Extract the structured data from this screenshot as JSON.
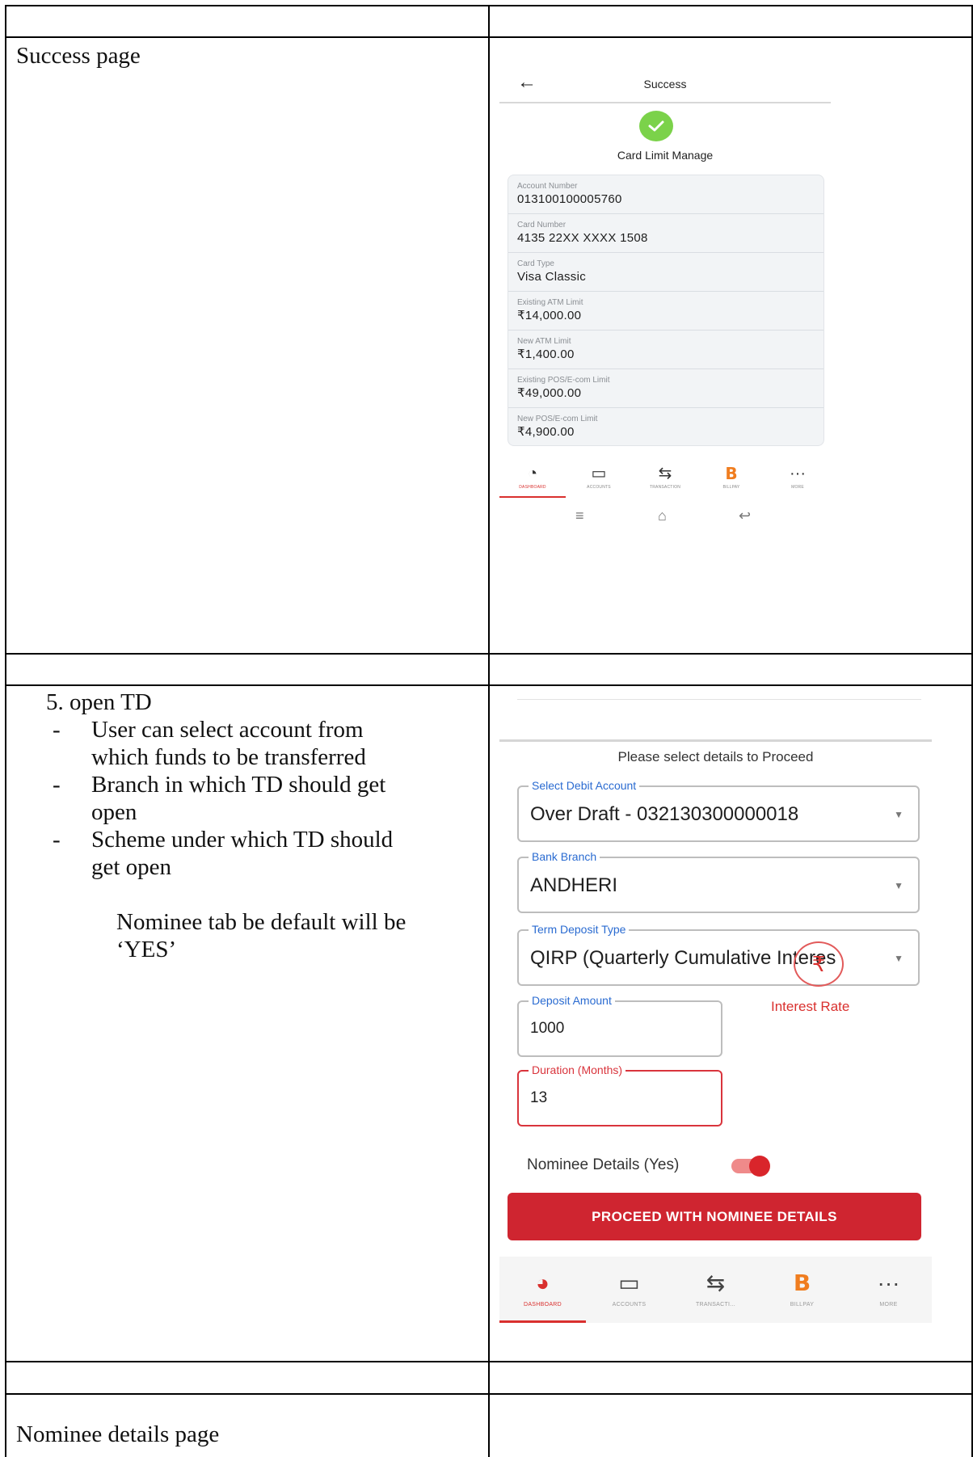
{
  "doc": {
    "row1_label": "Success page",
    "row2": {
      "item": "5.  open TD",
      "bullets": [
        "User can select account from",
        "which funds to be transferred",
        "Branch in which TD should get",
        "open",
        "Scheme under which TD should",
        "get open"
      ],
      "note_line1": "Nominee tab be default will be",
      "note_line2": "‘YES’"
    },
    "row3_label": "Nominee details page"
  },
  "success_screen": {
    "back_icon": "arrow-left-icon",
    "title": "Success",
    "status_icon": "check-circle-icon",
    "subtitle": "Card Limit Manage",
    "details": [
      {
        "label": "Account Number",
        "value": "013100100005760"
      },
      {
        "label": "Card Number",
        "value": "4135 22XX XXXX 1508"
      },
      {
        "label": "Card Type",
        "value": "Visa Classic"
      },
      {
        "label": "Existing ATM Limit",
        "value": "₹14,000.00"
      },
      {
        "label": "New ATM Limit",
        "value": "₹1,400.00"
      },
      {
        "label": "Existing POS/E-com Limit",
        "value": "₹49,000.00"
      },
      {
        "label": "New POS/E-com Limit",
        "value": "₹4,900.00"
      }
    ],
    "tabs": [
      {
        "label": "DASHBOARD",
        "icon": "dashboard-icon"
      },
      {
        "label": "ACCOUNTS",
        "icon": "wallet-icon"
      },
      {
        "label": "TRANSACTION",
        "icon": "transfer-icon"
      },
      {
        "label": "BILLPAY",
        "icon": "billpay-icon"
      },
      {
        "label": "MORE",
        "icon": "more-icon"
      }
    ],
    "active_tab": "DASHBOARD",
    "accent_color": "#d9302e",
    "success_color": "#7bd24a"
  },
  "open_td_screen": {
    "hint": "Please select details to Proceed",
    "debit_account": {
      "label": "Select Debit Account",
      "value": "Over Draft - 032130300000018"
    },
    "bank_branch": {
      "label": "Bank Branch",
      "value": "ANDHERI"
    },
    "deposit_type": {
      "label": "Term Deposit Type",
      "value": "QIRP (Quarterly Cumulative Interes"
    },
    "deposit_amount": {
      "label": "Deposit Amount",
      "value": "1000"
    },
    "duration": {
      "label": "Duration (Months)",
      "value": "13"
    },
    "interest_rate_label": "Interest Rate",
    "rupee_symbol": "₹",
    "nominee_toggle_label": "Nominee Details (Yes)",
    "nominee_toggle_on": true,
    "proceed_button": "PROCEED WITH NOMINEE DETAILS",
    "tabs": [
      {
        "label": "DASHBOARD",
        "icon": "dashboard-icon"
      },
      {
        "label": "ACCOUNTS",
        "icon": "wallet-icon"
      },
      {
        "label": "TRANSACTI...",
        "icon": "transfer-icon"
      },
      {
        "label": "BILLPAY",
        "icon": "billpay-icon"
      },
      {
        "label": "MORE",
        "icon": "more-icon"
      }
    ],
    "active_tab": "DASHBOARD",
    "primary_color": "#cf2530"
  }
}
